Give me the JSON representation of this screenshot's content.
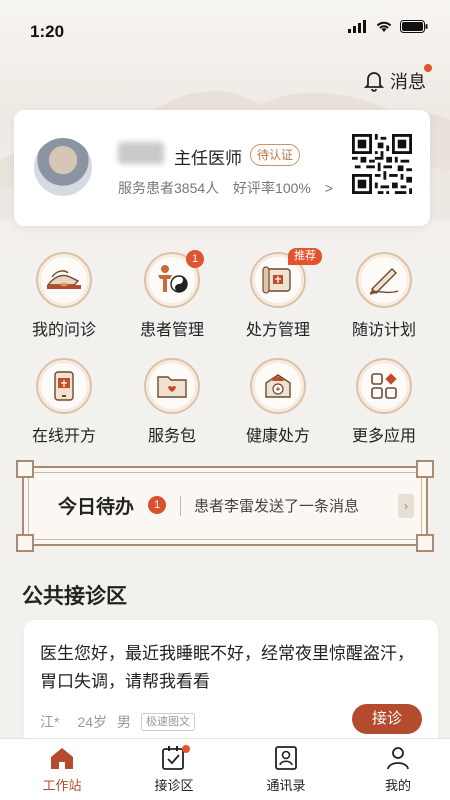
{
  "status": {
    "time": "1:20"
  },
  "header": {
    "message_label": "消息"
  },
  "profile": {
    "title": "主任医师",
    "badge": "待认证",
    "patients": "服务患者3854人",
    "rating": "好评率100%",
    "chevron": ">"
  },
  "grid": [
    {
      "label": "我的问诊",
      "icon": "consult-icon"
    },
    {
      "label": "患者管理",
      "icon": "patient-manage-icon",
      "badge": "1"
    },
    {
      "label": "处方管理",
      "icon": "prescription-manage-icon",
      "tag": "推荐"
    },
    {
      "label": "随访计划",
      "icon": "followup-icon"
    },
    {
      "label": "在线开方",
      "icon": "online-prescribe-icon"
    },
    {
      "label": "服务包",
      "icon": "service-package-icon"
    },
    {
      "label": "健康处方",
      "icon": "health-prescription-icon"
    },
    {
      "label": "更多应用",
      "icon": "more-apps-icon"
    }
  ],
  "todo": {
    "title": "今日待办",
    "count": "1",
    "message": "患者李雷发送了一条消息",
    "arrow": "›"
  },
  "public": {
    "section_title": "公共接诊区",
    "card": {
      "text": "医生您好，最近我睡眠不好，经常夜里惊醒盗汗，胃口失调，请帮我看看",
      "name": "江*",
      "age": "24岁",
      "gender": "男",
      "tag": "极速图文",
      "button": "接诊"
    }
  },
  "tabs": [
    {
      "label": "工作站",
      "icon": "home-icon",
      "active": true
    },
    {
      "label": "接诊区",
      "icon": "checklist-icon"
    },
    {
      "label": "通讯录",
      "icon": "contacts-icon"
    },
    {
      "label": "我的",
      "icon": "profile-icon"
    }
  ],
  "colors": {
    "accent": "#b44a2e",
    "badge": "#e0542e",
    "frame": "#a88b72"
  }
}
